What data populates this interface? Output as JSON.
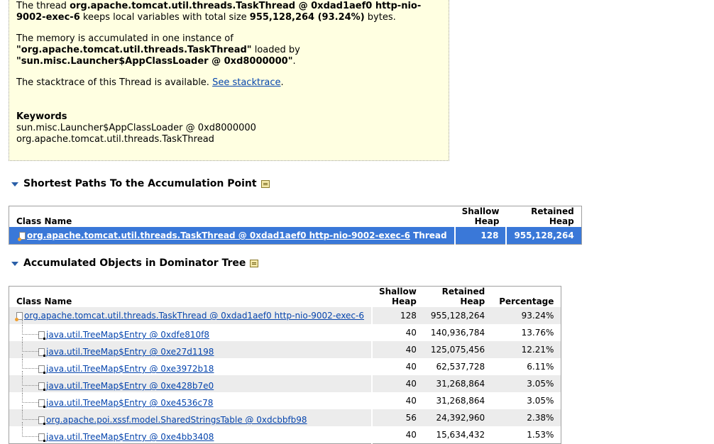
{
  "description": {
    "line1_pre": "The thread ",
    "line1_bold": "org.apache.tomcat.util.threads.TaskThread @ 0xdad1aef0 http-nio-",
    "line2_bold": "9002-exec-6",
    "line2_mid": " keeps local variables with total size ",
    "line2_size": "955,128,264 (93.24%)",
    "line2_post": " bytes.",
    "p2_line1": "The memory is accumulated in one instance of",
    "p2_class": "\"org.apache.tomcat.util.threads.TaskThread\"",
    "p2_loaded": " loaded by",
    "p2_loader": "\"sun.misc.Launcher$AppClassLoader @ 0xd8000000\"",
    "p2_end": ".",
    "p3_pre": "The stacktrace of this Thread is available. ",
    "p3_link": "See stacktrace",
    "p3_end": ".",
    "keywords_title": "Keywords",
    "keywords": [
      "sun.misc.Launcher$AppClassLoader @ 0xd8000000",
      "org.apache.tomcat.util.threads.TaskThread"
    ]
  },
  "shortest_paths": {
    "title": "Shortest Paths To the Accumulation Point",
    "headers": [
      "Class Name",
      "Shallow Heap",
      "Retained Heap"
    ],
    "row": {
      "name": "org.apache.tomcat.util.threads.TaskThread @ 0xdad1aef0 http-nio-9002-exec-6",
      "suffix": " Thread",
      "shallow": "128",
      "retained": "955,128,264"
    }
  },
  "dominator": {
    "title": "Accumulated Objects in Dominator Tree",
    "headers": [
      "Class Name",
      "Shallow Heap",
      "Retained Heap",
      "Percentage"
    ],
    "rows": [
      {
        "name": "org.apache.tomcat.util.threads.TaskThread @ 0xdad1aef0 http-nio-9002-exec-6",
        "shallow": "128",
        "retained": "955,128,264",
        "pct": "93.24%"
      },
      {
        "name": "java.util.TreeMap$Entry @ 0xdfe810f8",
        "shallow": "40",
        "retained": "140,936,784",
        "pct": "13.76%"
      },
      {
        "name": "java.util.TreeMap$Entry @ 0xe27d1198",
        "shallow": "40",
        "retained": "125,075,456",
        "pct": "12.21%"
      },
      {
        "name": "java.util.TreeMap$Entry @ 0xe3972b18",
        "shallow": "40",
        "retained": "62,537,728",
        "pct": "6.11%"
      },
      {
        "name": "java.util.TreeMap$Entry @ 0xe428b7e0",
        "shallow": "40",
        "retained": "31,268,864",
        "pct": "3.05%"
      },
      {
        "name": "java.util.TreeMap$Entry @ 0xe4536c78",
        "shallow": "40",
        "retained": "31,268,864",
        "pct": "3.05%"
      },
      {
        "name": "org.apache.poi.xssf.model.SharedStringsTable @ 0xdcbbfb98",
        "shallow": "56",
        "retained": "24,392,960",
        "pct": "2.38%"
      },
      {
        "name": "java.util.TreeMap$Entry @ 0xe4bb3408",
        "shallow": "40",
        "retained": "15,634,432",
        "pct": "1.53%"
      }
    ]
  }
}
